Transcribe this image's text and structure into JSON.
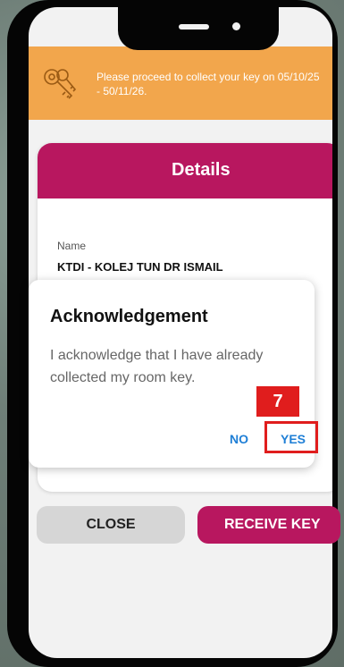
{
  "banner": {
    "message": "Please proceed to collect your key on 05/10/25 - 50/11/26.",
    "icon": "key-icon",
    "color": "#f2a64c"
  },
  "card": {
    "title": "Details",
    "field_label": "Name",
    "field_value": "KTDI - KOLEJ TUN DR ISMAIL",
    "accent": "#b8175f"
  },
  "dialog": {
    "title": "Acknowledgement",
    "body": "I acknowledge that I have already collected my room key.",
    "no_label": "NO",
    "yes_label": "YES"
  },
  "annotation": {
    "step": "7",
    "color": "#e01d1d"
  },
  "buttons": {
    "close_label": "CLOSE",
    "receive_label": "RECEIVE KEY"
  }
}
